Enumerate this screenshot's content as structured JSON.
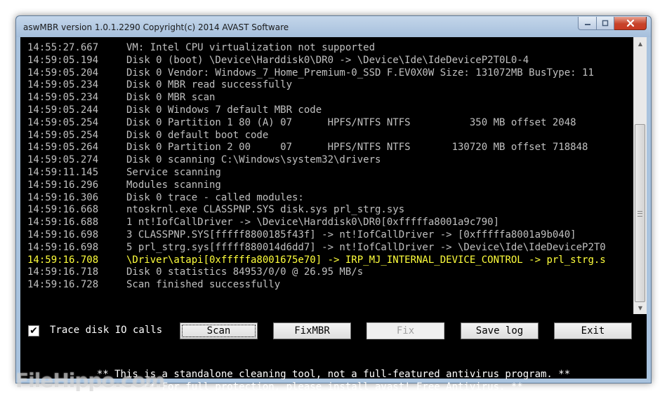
{
  "window": {
    "title": "aswMBR version 1.0.1.2290 Copyright(c) 2014 AVAST Software"
  },
  "titlebar_icons": {
    "minimize": "minimize-icon",
    "maximize": "maximize-icon",
    "close": "close-icon"
  },
  "log": [
    {
      "time": "14:55:27.667",
      "msg": "VM: Intel CPU virtualization not supported",
      "highlight": false
    },
    {
      "time": "14:59:05.194",
      "msg": "Disk 0 (boot) \\Device\\Harddisk0\\DR0 -> \\Device\\Ide\\IdeDeviceP2T0L0-4",
      "highlight": false
    },
    {
      "time": "14:59:05.204",
      "msg": "Disk 0 Vendor: Windows_7_Home_Premium-0_SSD F.EV0X0W Size: 131072MB BusType: 11",
      "highlight": false
    },
    {
      "time": "14:59:05.234",
      "msg": "Disk 0 MBR read successfully",
      "highlight": false
    },
    {
      "time": "14:59:05.234",
      "msg": "Disk 0 MBR scan",
      "highlight": false
    },
    {
      "time": "14:59:05.244",
      "msg": "Disk 0 Windows 7 default MBR code",
      "highlight": false
    },
    {
      "time": "14:59:05.254",
      "msg": "Disk 0 Partition 1 80 (A) 07      HPFS/NTFS NTFS          350 MB offset 2048",
      "highlight": false
    },
    {
      "time": "14:59:05.254",
      "msg": "Disk 0 default boot code",
      "highlight": false
    },
    {
      "time": "14:59:05.264",
      "msg": "Disk 0 Partition 2 00     07      HPFS/NTFS NTFS       130720 MB offset 718848",
      "highlight": false
    },
    {
      "time": "14:59:05.274",
      "msg": "Disk 0 scanning C:\\Windows\\system32\\drivers",
      "highlight": false
    },
    {
      "time": "14:59:11.145",
      "msg": "Service scanning",
      "highlight": false
    },
    {
      "time": "14:59:16.296",
      "msg": "Modules scanning",
      "highlight": false
    },
    {
      "time": "14:59:16.306",
      "msg": "Disk 0 trace - called modules:",
      "highlight": false
    },
    {
      "time": "14:59:16.668",
      "msg": "ntoskrnl.exe CLASSPNP.SYS disk.sys prl_strg.sys",
      "highlight": false
    },
    {
      "time": "14:59:16.688",
      "msg": "1 nt!IofCallDriver -> \\Device\\Harddisk0\\DR0[0xfffffa8001a9c790]",
      "highlight": false
    },
    {
      "time": "14:59:16.698",
      "msg": "3 CLASSPNP.SYS[fffff8800185f43f] -> nt!IofCallDriver -> [0xfffffa8001a9b040]",
      "highlight": false
    },
    {
      "time": "14:59:16.698",
      "msg": "5 prl_strg.sys[fffff880014d6dd7] -> nt!IofCallDriver -> \\Device\\Ide\\IdeDeviceP2T0",
      "highlight": false
    },
    {
      "time": "14:59:16.708",
      "msg": "\\Driver\\atapi[0xfffffa8001675e70] -> IRP_MJ_INTERNAL_DEVICE_CONTROL -> prl_strg.s",
      "highlight": true
    },
    {
      "time": "14:59:16.718",
      "msg": "Disk 0 statistics 84953/0/0 @ 26.95 MB/s",
      "highlight": false
    },
    {
      "time": "14:59:16.728",
      "msg": "Scan finished successfully",
      "highlight": false
    }
  ],
  "controls": {
    "trace_label": "Trace disk IO calls",
    "trace_checked": true,
    "check_mark": "✔",
    "scan": "Scan",
    "fixmbr": "FixMBR",
    "fix": "Fix",
    "save_log": "Save log",
    "exit": "Exit"
  },
  "notice": {
    "line1": "** This is a standalone cleaning tool, not a full-featured antivirus program. **",
    "line2": "** For full protection, please install avast! Free Antivirus. **"
  },
  "watermark": "FileHippo.com",
  "colors": {
    "console_bg": "#000000",
    "console_text": "#c0c0c0",
    "highlight_text": "#ffff3c",
    "close_button": "#c7442b"
  }
}
